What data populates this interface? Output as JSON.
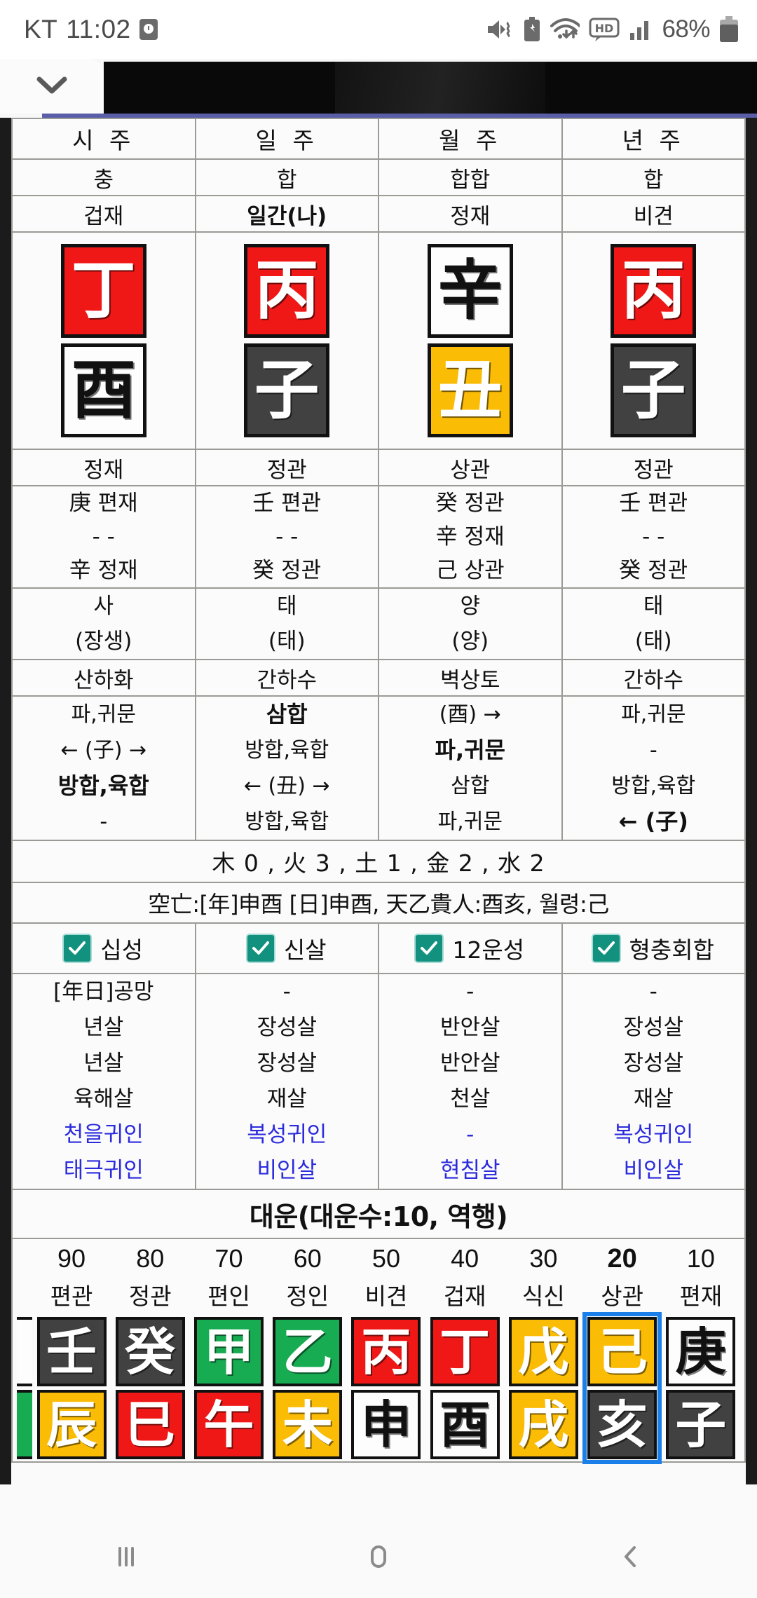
{
  "statusbar": {
    "carrier": "KT",
    "time": "11:02",
    "alarm_icon": "alarm-icon",
    "mute_icon": "sound-mute-vibrate-icon",
    "battery_saver_icon": "battery-saver-icon",
    "wifi_icon": "wifi-icon",
    "hd_icon": "hd-voice-icon",
    "signal_icon": "cellular-signal-icon",
    "battery_percent": "68%",
    "battery_icon": "battery-icon"
  },
  "chrome": {
    "collapse_icon": "chevron-down-icon",
    "ad_banner": ""
  },
  "table": {
    "pillars": [
      "시 주",
      "일 주",
      "월 주",
      "년 주"
    ],
    "hap_chung": [
      "충",
      "합",
      "합합",
      "합"
    ],
    "ten_gods_stem": [
      "겁재",
      "일간(나)",
      "정재",
      "비견"
    ],
    "ten_gods_stem_highlight": [
      false,
      true,
      false,
      false
    ],
    "heavenly_stems": [
      {
        "char": "丁",
        "color": "red"
      },
      {
        "char": "丙",
        "color": "red"
      },
      {
        "char": "辛",
        "color": "white"
      },
      {
        "char": "丙",
        "color": "red"
      }
    ],
    "earthly_branches": [
      {
        "char": "酉",
        "color": "white"
      },
      {
        "char": "子",
        "color": "black"
      },
      {
        "char": "丑",
        "color": "yellow"
      },
      {
        "char": "子",
        "color": "black"
      }
    ],
    "ten_gods_branch": [
      "정재",
      "정관",
      "상관",
      "정관"
    ],
    "hidden_stems": [
      [
        "庚 편재",
        "- -",
        "辛 정재"
      ],
      [
        "壬 편관",
        "- -",
        "癸 정관"
      ],
      [
        "癸 정관",
        "辛 정재",
        "己 상관"
      ],
      [
        "壬 편관",
        "- -",
        "癸 정관"
      ]
    ],
    "twelve_stages": [
      [
        "사",
        "(장생)"
      ],
      [
        "태",
        "(태)"
      ],
      [
        "양",
        "(양)"
      ],
      [
        "태",
        "(태)"
      ]
    ],
    "napeum": [
      "산하화",
      "간하수",
      "벽상토",
      "간하수"
    ],
    "relations": [
      [
        "파,귀문",
        "삼합",
        "(酉) →",
        "파,귀문"
      ],
      [
        "← (子) →",
        "방합,육합",
        "파,귀문",
        "-"
      ],
      [
        "방합,육합",
        "← (丑) →",
        "삼합",
        "방합,육합"
      ],
      [
        "-",
        "방합,육합",
        "파,귀문",
        "← (子)"
      ]
    ],
    "element_counts": "木 0 , 火 3 , 土 1 , 金 2 , 水 2",
    "extra_info": "空亡:[年]申酉 [日]申酉, 天乙貴人:酉亥, 월령:己",
    "checkboxes": [
      {
        "label": "십성",
        "checked": true
      },
      {
        "label": "신살",
        "checked": true
      },
      {
        "label": "12운성",
        "checked": true
      },
      {
        "label": "형충회합",
        "checked": true
      }
    ],
    "sinsal": [
      [
        "[年日]공망",
        "년살",
        "년살",
        "육해살",
        "천을귀인",
        "태극귀인"
      ],
      [
        "-",
        "장성살",
        "장성살",
        "재살",
        "복성귀인",
        "비인살"
      ],
      [
        "-",
        "반안살",
        "반안살",
        "천살",
        "-",
        "현침살"
      ],
      [
        "-",
        "장성살",
        "장성살",
        "재살",
        "복성귀인",
        "비인살"
      ]
    ]
  },
  "daeun": {
    "title": "대운(대운수:10, 역행)",
    "current_age": "20",
    "columns": [
      {
        "age": "90",
        "ten_god": "편관",
        "stem": "壬",
        "stem_color": "black",
        "branch": "辰",
        "branch_color": "yellow",
        "selected": false
      },
      {
        "age": "80",
        "ten_god": "정관",
        "stem": "癸",
        "stem_color": "black",
        "branch": "巳",
        "branch_color": "red",
        "selected": false
      },
      {
        "age": "70",
        "ten_god": "편인",
        "stem": "甲",
        "stem_color": "green",
        "branch": "午",
        "branch_color": "red",
        "selected": false
      },
      {
        "age": "60",
        "ten_god": "정인",
        "stem": "乙",
        "stem_color": "green",
        "branch": "未",
        "branch_color": "yellow",
        "selected": false
      },
      {
        "age": "50",
        "ten_god": "비견",
        "stem": "丙",
        "stem_color": "red",
        "branch": "申",
        "branch_color": "white",
        "selected": false
      },
      {
        "age": "40",
        "ten_god": "겁재",
        "stem": "丁",
        "stem_color": "red",
        "branch": "酉",
        "branch_color": "white",
        "selected": false
      },
      {
        "age": "30",
        "ten_god": "식신",
        "stem": "戊",
        "stem_color": "yellow",
        "branch": "戌",
        "branch_color": "yellow",
        "selected": false
      },
      {
        "age": "20",
        "ten_god": "상관",
        "stem": "己",
        "stem_color": "yellow",
        "branch": "亥",
        "branch_color": "black",
        "selected": true
      },
      {
        "age": "10",
        "ten_god": "편재",
        "stem": "庚",
        "stem_color": "white",
        "branch": "子",
        "branch_color": "black",
        "selected": false
      }
    ]
  },
  "navbar": {
    "recents_icon": "recent-apps-icon",
    "home_icon": "home-icon",
    "back_icon": "back-icon"
  },
  "colors": {
    "accent_blue": "#1a7fe8",
    "highlight_yellow": "#fbf4cd",
    "checkbox_teal": "#11917e",
    "link_blue": "#2b2bdd",
    "fire_red": "#f01717",
    "earth_yellow": "#fbbc05",
    "water_black": "#414141",
    "wood_green": "#17ab52",
    "metal_white": "#fdfdfd"
  }
}
